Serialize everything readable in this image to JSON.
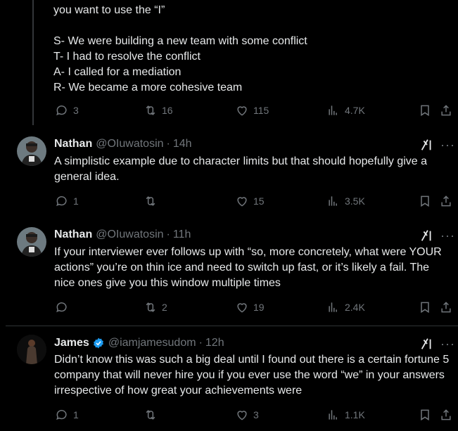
{
  "first_post": {
    "lines": [
      "you want to use the “I”",
      "",
      "S- We were building a new team with some conflict",
      "T- I had to resolve the conflict",
      "A- I called for a mediation",
      "R- We became a more cohesive team"
    ],
    "stats": {
      "replies": "3",
      "reposts": "16",
      "likes": "115",
      "views": "4.7K"
    }
  },
  "replies": [
    {
      "name": "Nathan",
      "handle": "@OIuwatosin",
      "time": "14h",
      "text": "A simplistic example due to character limits but that should hopefully give a general idea.",
      "stats": {
        "replies": "1",
        "reposts": "",
        "likes": "15",
        "views": "3.5K"
      }
    },
    {
      "name": "Nathan",
      "handle": "@OIuwatosin",
      "time": "11h",
      "text": "If your interviewer ever follows up with “so, more concretely, what were YOUR actions” you’re on thin ice and need to switch up fast, or it’s likely a fail. The nice ones give you this window multiple times",
      "stats": {
        "replies": "",
        "reposts": "2",
        "likes": "19",
        "views": "2.4K"
      }
    },
    {
      "name": "James",
      "handle": "@iamjamesudom",
      "time": "12h",
      "verified": true,
      "text": "Didn’t know this was such a big deal until I found out there is a certain fortune 5 company that will never hire you if you ever use the word “we” in your answers irrespective of how great your achievements were",
      "stats": {
        "replies": "1",
        "reposts": "",
        "likes": "3",
        "views": "1.1K"
      }
    }
  ],
  "ui": {
    "separator": "·",
    "more": "···"
  },
  "colors": {
    "background": "#000000",
    "text": "#e7e9ea",
    "muted": "#71767b",
    "verified": "#1d9bf0",
    "divider": "#2f3336"
  }
}
